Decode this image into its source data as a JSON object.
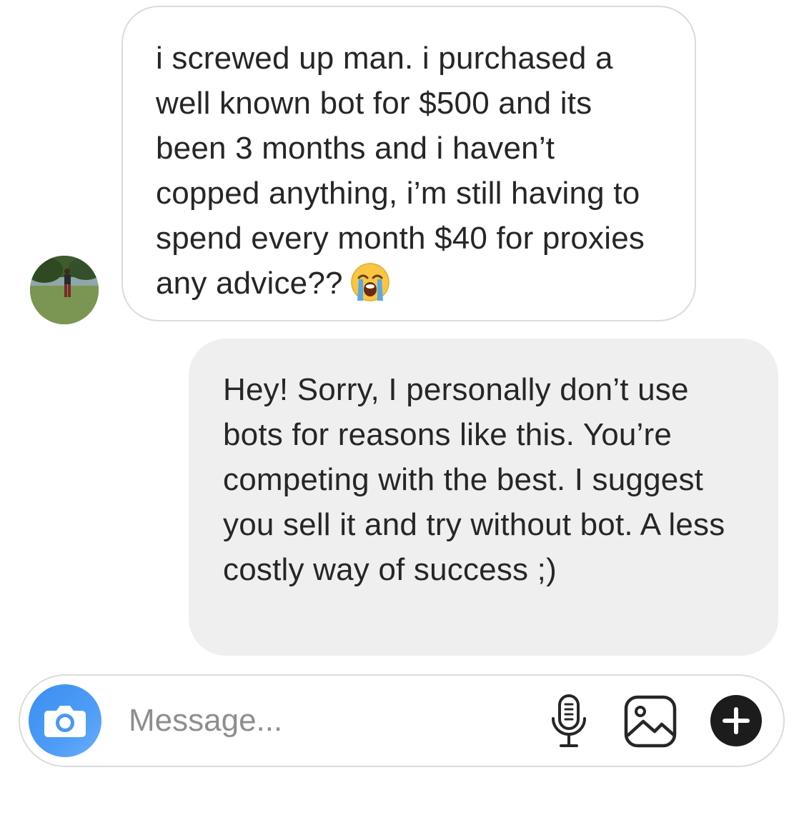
{
  "thread": {
    "messages": [
      {
        "direction": "incoming",
        "text": "i screwed up man. i purchased a well known bot for $500 and its been 3 months and i haven’t copped anything, i’m still having to spend every month $40 for proxies any advice??",
        "emoji": "loudly-crying-face"
      },
      {
        "direction": "outgoing",
        "text": "Hey! Sorry, I personally don’t use bots for reasons like this. You’re competing with the best. I suggest you sell it and try without bot. A less costly way of success ;)"
      }
    ]
  },
  "composer": {
    "placeholder": "Message...",
    "camera_icon": "camera-icon",
    "mic_icon": "microphone-icon",
    "gallery_icon": "gallery-icon",
    "plus_icon": "plus-icon"
  },
  "colors": {
    "incoming_bubble_border": "#dbdbdb",
    "outgoing_bubble_bg": "#efefef",
    "text": "#262626",
    "placeholder": "#8e8e8e",
    "camera_blue": "#3b8ff0"
  }
}
